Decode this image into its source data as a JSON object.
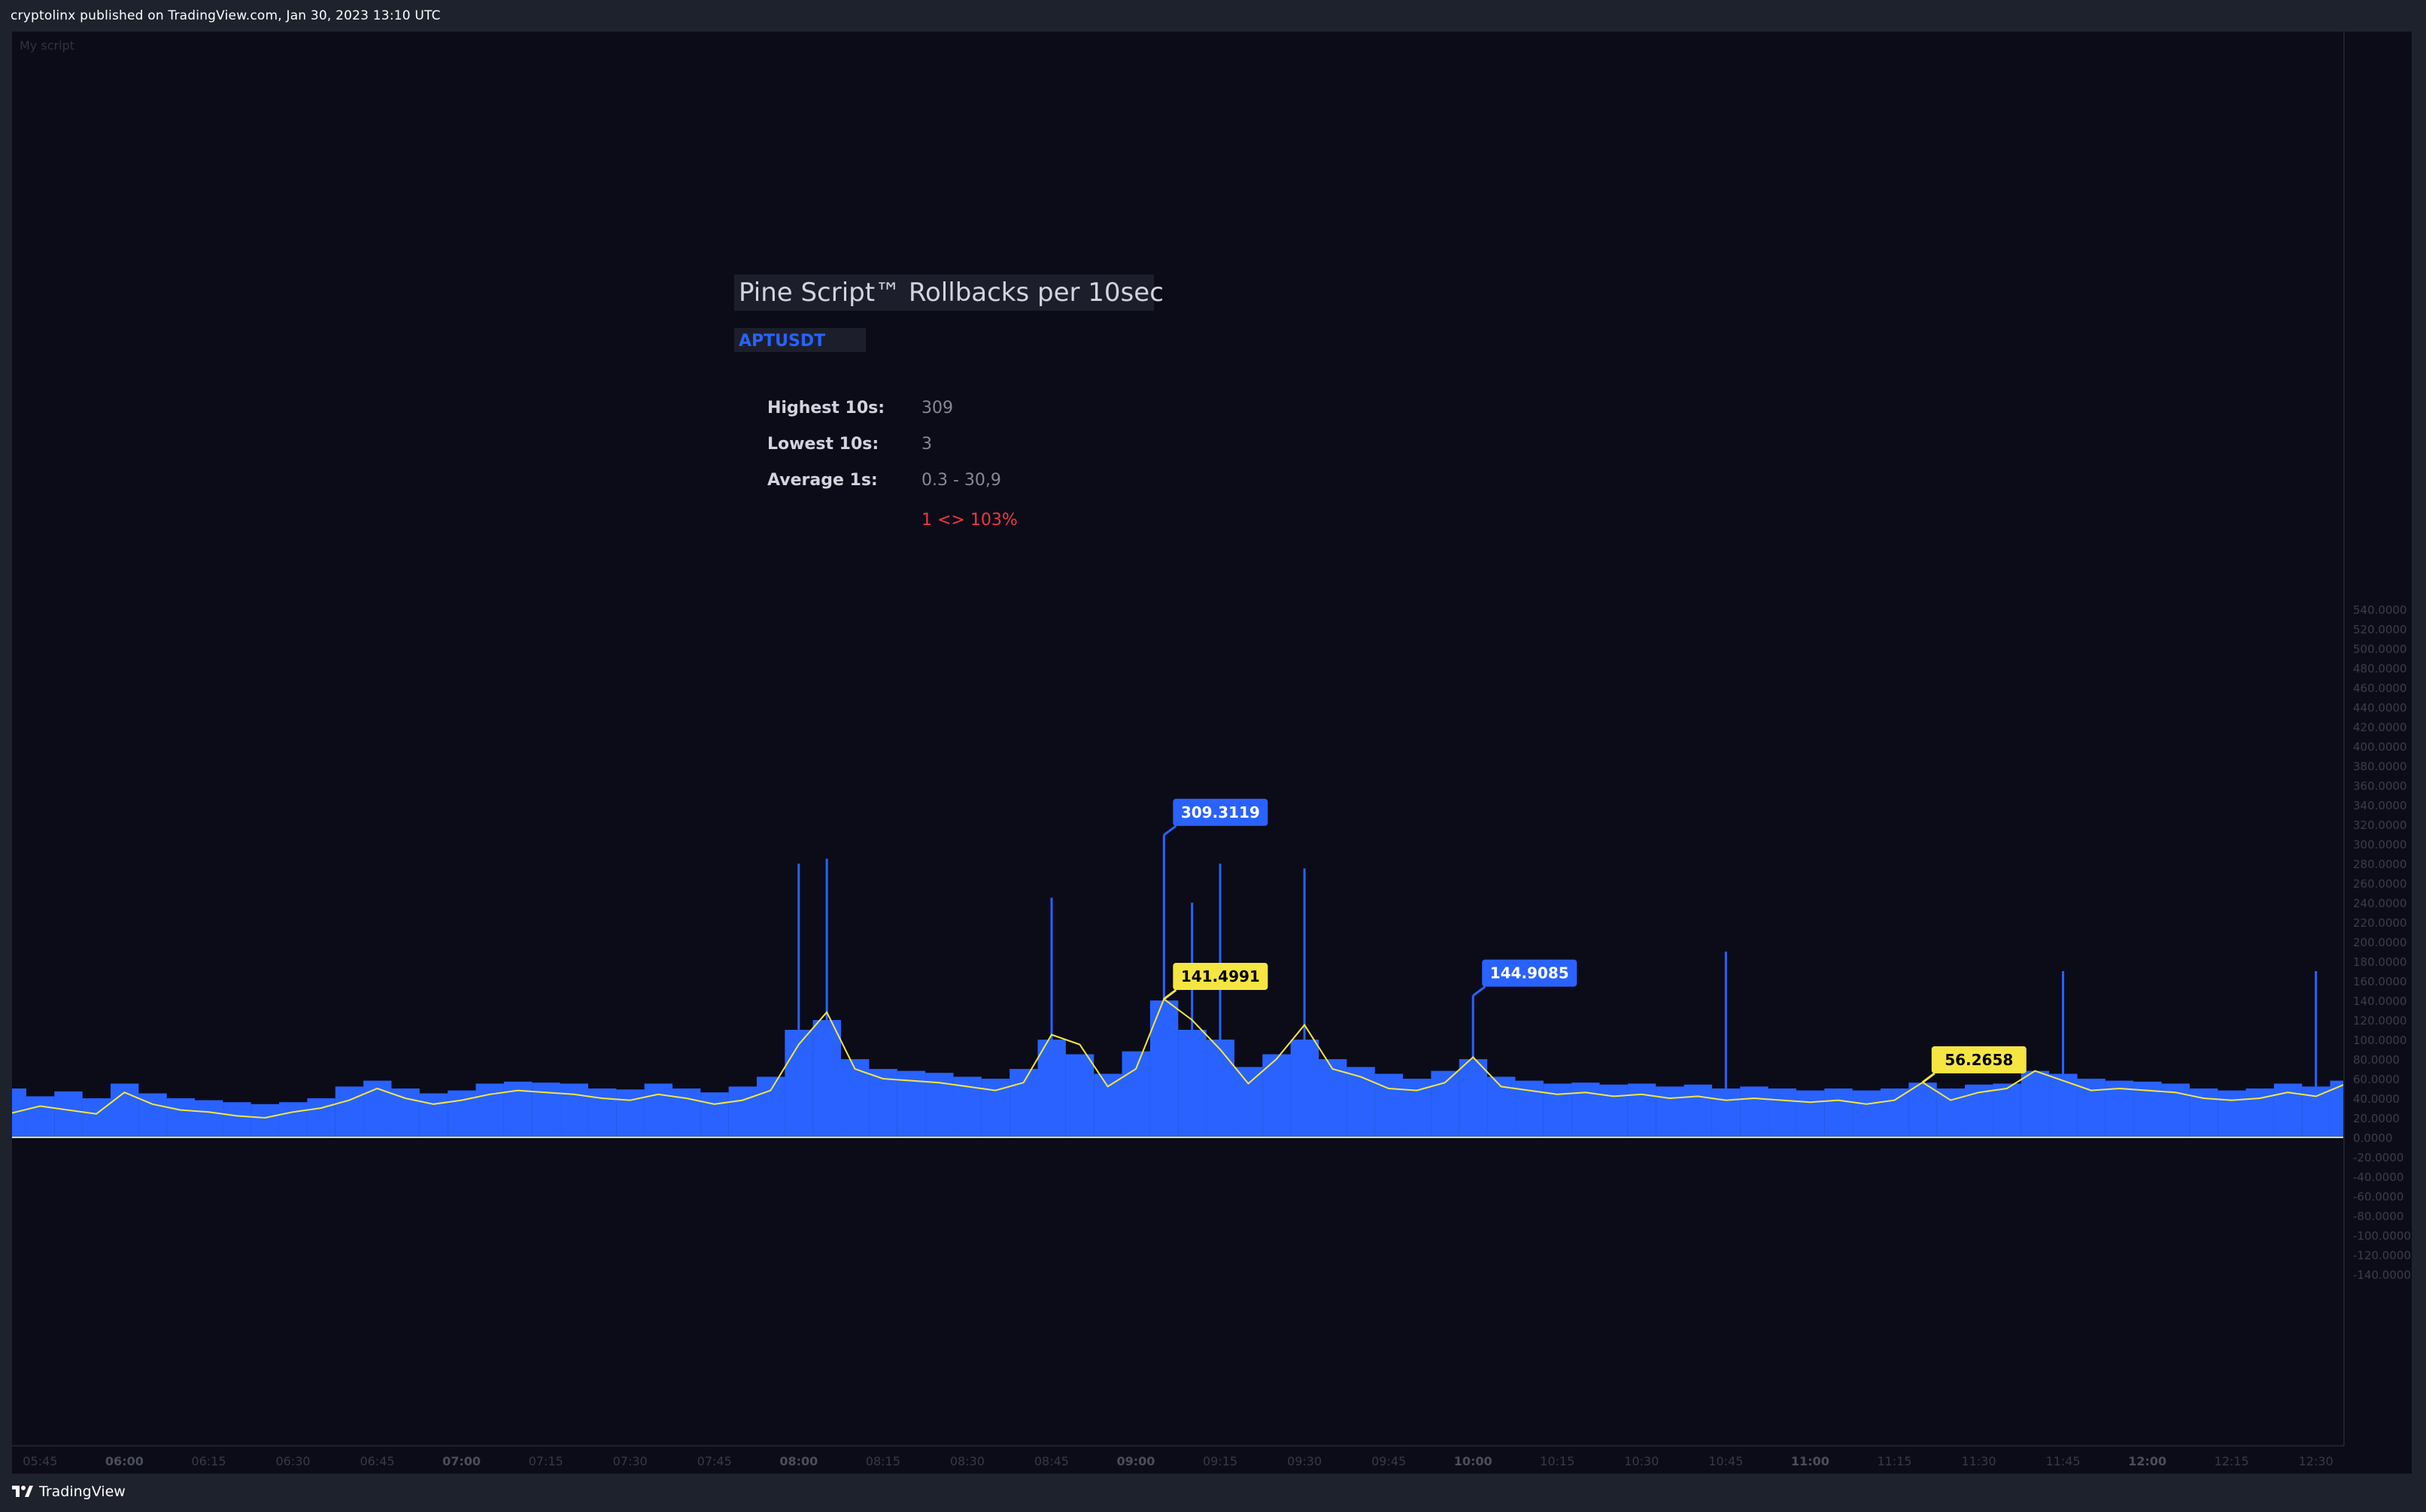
{
  "header": {
    "publish_line": "cryptolinx published on TradingView.com, Jan 30, 2023 13:10 UTC"
  },
  "footer": {
    "brand": "TradingView"
  },
  "pane": {
    "indicator_name": "My script"
  },
  "info_panel": {
    "title": "Pine Script™ Rollbacks per 10sec",
    "symbol": "APTUSDT",
    "rows": [
      {
        "label": "Highest 10s:",
        "value": "309"
      },
      {
        "label": "Lowest 10s:",
        "value": "3"
      },
      {
        "label": "Average 1s:",
        "value": "0.3 - 30,9"
      }
    ],
    "ratio": "1 <> 103%"
  },
  "colors": {
    "background": "#0c0c18",
    "bars": "#2962ff",
    "line": "#f5e642",
    "label_blue": "#2962ff",
    "label_yellow": "#f5e642",
    "ratio_red": "#f23645",
    "symbol_blue": "#2962ff"
  },
  "chart_data": {
    "type": "bar",
    "title": "Pine Script™ Rollbacks per 10sec",
    "series": [
      {
        "name": "Rollbacks per 10s",
        "style": "histogram",
        "color": "#2962ff",
        "points": [
          [
            "05:40",
            50
          ],
          [
            "05:45",
            42
          ],
          [
            "05:50",
            47
          ],
          [
            "05:55",
            40
          ],
          [
            "06:00",
            55
          ],
          [
            "06:05",
            45
          ],
          [
            "06:10",
            40
          ],
          [
            "06:15",
            38
          ],
          [
            "06:20",
            36
          ],
          [
            "06:25",
            34
          ],
          [
            "06:30",
            36
          ],
          [
            "06:35",
            40
          ],
          [
            "06:40",
            52
          ],
          [
            "06:45",
            58
          ],
          [
            "06:50",
            50
          ],
          [
            "06:55",
            45
          ],
          [
            "07:00",
            48
          ],
          [
            "07:05",
            55
          ],
          [
            "07:10",
            57
          ],
          [
            "07:15",
            56
          ],
          [
            "07:20",
            55
          ],
          [
            "07:25",
            50
          ],
          [
            "07:30",
            49
          ],
          [
            "07:35",
            55
          ],
          [
            "07:40",
            50
          ],
          [
            "07:45",
            46
          ],
          [
            "07:50",
            52
          ],
          [
            "07:55",
            62
          ],
          [
            "08:00",
            110
          ],
          [
            "08:05",
            120
          ],
          [
            "08:10",
            80
          ],
          [
            "08:15",
            70
          ],
          [
            "08:20",
            68
          ],
          [
            "08:25",
            66
          ],
          [
            "08:30",
            62
          ],
          [
            "08:35",
            60
          ],
          [
            "08:40",
            70
          ],
          [
            "08:45",
            100
          ],
          [
            "08:50",
            85
          ],
          [
            "08:55",
            65
          ],
          [
            "09:00",
            88
          ],
          [
            "09:05",
            140
          ],
          [
            "09:10",
            110
          ],
          [
            "09:15",
            100
          ],
          [
            "09:20",
            72
          ],
          [
            "09:25",
            85
          ],
          [
            "09:30",
            100
          ],
          [
            "09:35",
            80
          ],
          [
            "09:40",
            72
          ],
          [
            "09:45",
            65
          ],
          [
            "09:50",
            60
          ],
          [
            "09:55",
            68
          ],
          [
            "10:00",
            80
          ],
          [
            "10:05",
            62
          ],
          [
            "10:10",
            58
          ],
          [
            "10:15",
            55
          ],
          [
            "10:20",
            56
          ],
          [
            "10:25",
            54
          ],
          [
            "10:30",
            55
          ],
          [
            "10:35",
            52
          ],
          [
            "10:40",
            54
          ],
          [
            "10:45",
            50
          ],
          [
            "10:50",
            52
          ],
          [
            "10:55",
            50
          ],
          [
            "11:00",
            48
          ],
          [
            "11:05",
            50
          ],
          [
            "11:10",
            48
          ],
          [
            "11:15",
            50
          ],
          [
            "11:20",
            56
          ],
          [
            "11:25",
            50
          ],
          [
            "11:30",
            54
          ],
          [
            "11:35",
            55
          ],
          [
            "11:40",
            68
          ],
          [
            "11:45",
            65
          ],
          [
            "11:50",
            60
          ],
          [
            "11:55",
            58
          ],
          [
            "12:00",
            57
          ],
          [
            "12:05",
            55
          ],
          [
            "12:10",
            50
          ],
          [
            "12:15",
            48
          ],
          [
            "12:20",
            50
          ],
          [
            "12:25",
            55
          ],
          [
            "12:30",
            52
          ],
          [
            "12:35",
            58
          ]
        ]
      },
      {
        "name": "Moving average",
        "style": "line",
        "color": "#f5e642",
        "points": [
          [
            "05:40",
            25
          ],
          [
            "05:45",
            32
          ],
          [
            "05:50",
            28
          ],
          [
            "05:55",
            24
          ],
          [
            "06:00",
            46
          ],
          [
            "06:05",
            34
          ],
          [
            "06:10",
            28
          ],
          [
            "06:15",
            26
          ],
          [
            "06:20",
            22
          ],
          [
            "06:25",
            20
          ],
          [
            "06:30",
            26
          ],
          [
            "06:35",
            30
          ],
          [
            "06:40",
            38
          ],
          [
            "06:45",
            50
          ],
          [
            "06:50",
            40
          ],
          [
            "06:55",
            34
          ],
          [
            "07:00",
            38
          ],
          [
            "07:05",
            44
          ],
          [
            "07:10",
            48
          ],
          [
            "07:15",
            46
          ],
          [
            "07:20",
            44
          ],
          [
            "07:25",
            40
          ],
          [
            "07:30",
            38
          ],
          [
            "07:35",
            44
          ],
          [
            "07:40",
            40
          ],
          [
            "07:45",
            34
          ],
          [
            "07:50",
            38
          ],
          [
            "07:55",
            48
          ],
          [
            "08:00",
            95
          ],
          [
            "08:05",
            128
          ],
          [
            "08:10",
            70
          ],
          [
            "08:15",
            60
          ],
          [
            "08:20",
            58
          ],
          [
            "08:25",
            56
          ],
          [
            "08:30",
            52
          ],
          [
            "08:35",
            48
          ],
          [
            "08:40",
            56
          ],
          [
            "08:45",
            105
          ],
          [
            "08:50",
            95
          ],
          [
            "08:55",
            52
          ],
          [
            "09:00",
            70
          ],
          [
            "09:05",
            141.4991
          ],
          [
            "09:10",
            120
          ],
          [
            "09:15",
            90
          ],
          [
            "09:20",
            55
          ],
          [
            "09:25",
            80
          ],
          [
            "09:30",
            115
          ],
          [
            "09:35",
            70
          ],
          [
            "09:40",
            62
          ],
          [
            "09:45",
            50
          ],
          [
            "09:50",
            48
          ],
          [
            "09:55",
            56
          ],
          [
            "10:00",
            82
          ],
          [
            "10:05",
            52
          ],
          [
            "10:10",
            48
          ],
          [
            "10:15",
            44
          ],
          [
            "10:20",
            46
          ],
          [
            "10:25",
            42
          ],
          [
            "10:30",
            44
          ],
          [
            "10:35",
            40
          ],
          [
            "10:40",
            42
          ],
          [
            "10:45",
            38
          ],
          [
            "10:50",
            40
          ],
          [
            "10:55",
            38
          ],
          [
            "11:00",
            36
          ],
          [
            "11:05",
            38
          ],
          [
            "11:10",
            34
          ],
          [
            "11:15",
            38
          ],
          [
            "11:20",
            56.2658
          ],
          [
            "11:25",
            38
          ],
          [
            "11:30",
            46
          ],
          [
            "11:35",
            50
          ],
          [
            "11:40",
            68
          ],
          [
            "11:45",
            58
          ],
          [
            "11:50",
            48
          ],
          [
            "11:55",
            50
          ],
          [
            "12:00",
            48
          ],
          [
            "12:05",
            46
          ],
          [
            "12:10",
            40
          ],
          [
            "12:15",
            38
          ],
          [
            "12:20",
            40
          ],
          [
            "12:25",
            46
          ],
          [
            "12:30",
            42
          ],
          [
            "12:35",
            54
          ]
        ]
      }
    ],
    "spikes": [
      [
        "08:00",
        280
      ],
      [
        "08:05",
        285
      ],
      [
        "09:05",
        309.3119
      ],
      [
        "09:15",
        280
      ],
      [
        "09:30",
        275
      ],
      [
        "09:10",
        240
      ],
      [
        "08:45",
        245
      ],
      [
        "10:00",
        144.9085
      ],
      [
        "10:45",
        190
      ],
      [
        "11:45",
        170
      ],
      [
        "12:30",
        170
      ]
    ],
    "annotations": [
      {
        "x": "09:05",
        "y": 309.3119,
        "text": "309.3119",
        "color": "#2962ff"
      },
      {
        "x": "09:05",
        "y": 141.4991,
        "text": "141.4991",
        "color": "#f5e642"
      },
      {
        "x": "10:00",
        "y": 144.9085,
        "text": "144.9085",
        "color": "#2962ff"
      },
      {
        "x": "11:20",
        "y": 56.2658,
        "text": "56.2658",
        "color": "#f5e642"
      }
    ],
    "x_ticks": [
      "05:45",
      "06:00",
      "06:15",
      "06:30",
      "06:45",
      "07:00",
      "07:15",
      "07:30",
      "07:45",
      "08:00",
      "08:15",
      "08:30",
      "08:45",
      "09:00",
      "09:15",
      "09:30",
      "09:45",
      "10:00",
      "10:15",
      "10:30",
      "10:45",
      "11:00",
      "11:15",
      "11:30",
      "11:45",
      "12:00",
      "12:15",
      "12:30"
    ],
    "x_bold_ticks": [
      "06:00",
      "07:00",
      "08:00",
      "09:00",
      "10:00",
      "11:00",
      "12:00"
    ],
    "y_ticks": [
      "540.0000",
      "520.0000",
      "500.0000",
      "480.0000",
      "460.0000",
      "440.0000",
      "420.0000",
      "400.0000",
      "380.0000",
      "360.0000",
      "340.0000",
      "320.0000",
      "300.0000",
      "280.0000",
      "260.0000",
      "240.0000",
      "220.0000",
      "200.0000",
      "180.0000",
      "160.0000",
      "140.0000",
      "120.0000",
      "100.0000",
      "80.0000",
      "60.0000",
      "40.0000",
      "20.0000",
      "0.0000",
      "-20.0000",
      "-40.0000",
      "-60.0000",
      "-80.0000",
      "-100.0000",
      "-120.0000",
      "-140.0000"
    ],
    "x_range": [
      "05:40",
      "12:35"
    ],
    "ylim": [
      -150,
      550
    ],
    "grid": false
  }
}
